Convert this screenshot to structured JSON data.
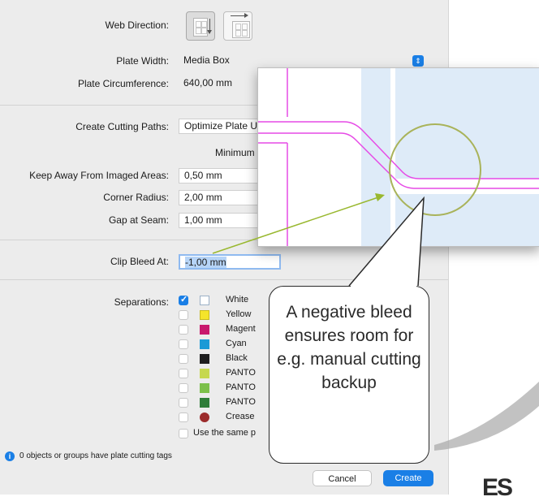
{
  "form": {
    "web_direction_label": "Web Direction:",
    "plate_width_label": "Plate Width:",
    "plate_width_value": "Media Box",
    "plate_circumference_label": "Plate Circumference:",
    "plate_circumference_value": "640,00 mm",
    "create_cutting_paths_label": "Create Cutting Paths:",
    "create_cutting_paths_value": "Optimize Plate U",
    "minimum_label": "Minimum",
    "keep_away_label": "Keep Away From Imaged Areas:",
    "keep_away_value": "0,50 mm",
    "corner_radius_label": "Corner Radius:",
    "corner_radius_value": "2,00 mm",
    "gap_at_seam_label": "Gap at Seam:",
    "gap_at_seam_value": "1,00 mm",
    "clip_bleed_label": "Clip Bleed At:",
    "clip_bleed_value": "-1,00 mm",
    "separations_label": "Separations:"
  },
  "separations": [
    {
      "name": "White",
      "checked": true,
      "color": "#ffffff"
    },
    {
      "name": "Yellow",
      "checked": false,
      "color": "#f5e52a"
    },
    {
      "name": "Magent",
      "checked": false,
      "color": "#c8186c"
    },
    {
      "name": "Cyan",
      "checked": false,
      "color": "#1b9ad6"
    },
    {
      "name": "Black",
      "checked": false,
      "color": "#1e1e1e"
    },
    {
      "name": "PANTO",
      "checked": false,
      "color": "#c6d84f"
    },
    {
      "name": "PANTO",
      "checked": false,
      "color": "#7cc04a"
    },
    {
      "name": "PANTO",
      "checked": false,
      "color": "#2f7d39"
    },
    {
      "name": "Crease",
      "checked": false,
      "color": "#9b2b2b"
    }
  ],
  "use_same_label": "Use the same p",
  "info_text": "0 objects or groups have plate cutting tags",
  "buttons": {
    "cancel": "Cancel",
    "create": "Create"
  },
  "callout_text": "A negative bleed ensures room for e.g. manual cutting backup",
  "logo_text": "ES",
  "colors": {
    "accent": "#1a7fe6",
    "cut_path": "#e64ae6",
    "zoom_fill": "#deebf8",
    "callout_circle": "#a9b35a",
    "arrow": "#99b82f"
  }
}
